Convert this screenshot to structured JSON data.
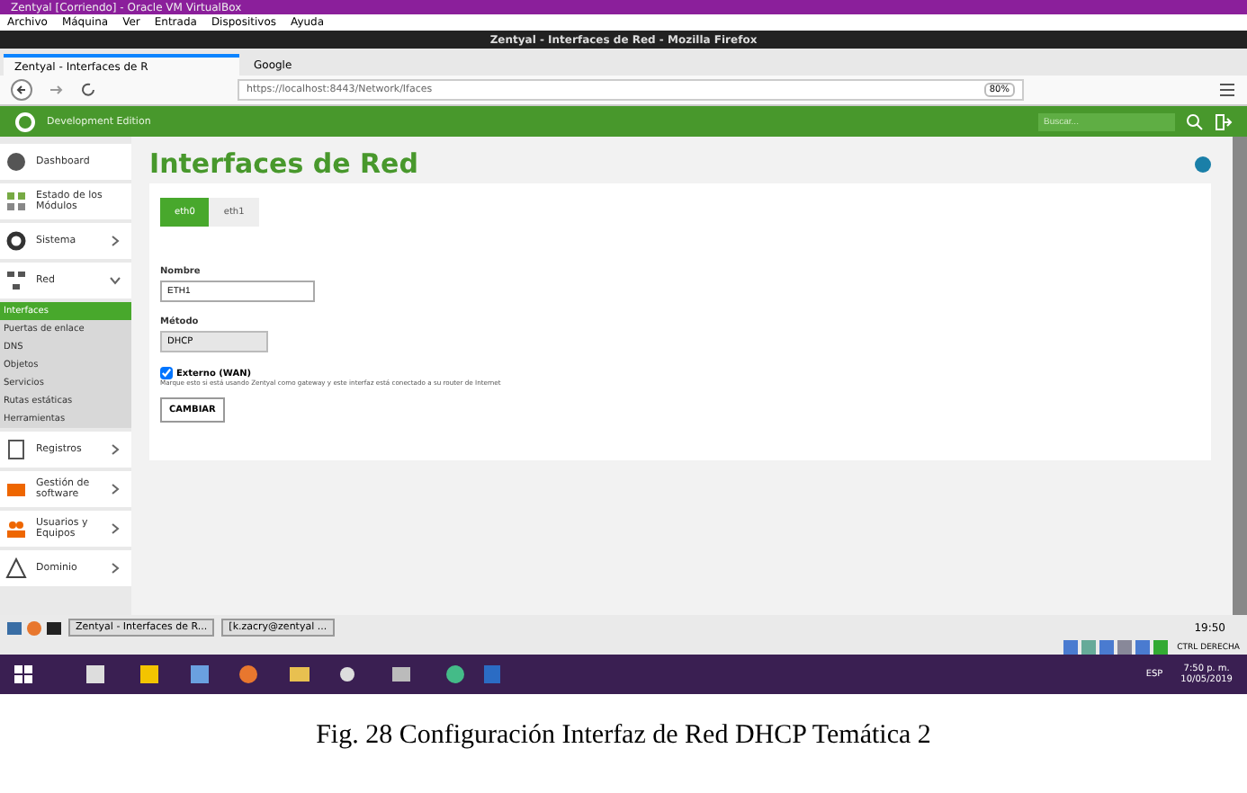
{
  "vm_window": {
    "title": "Zentyal [Corriendo] - Oracle VM VirtualBox",
    "menu": [
      "Archivo",
      "Máquina",
      "Ver",
      "Entrada",
      "Dispositivos",
      "Ayuda"
    ]
  },
  "browser": {
    "title": "Zentyal - Interfaces de Red - Mozilla Firefox",
    "tabs": [
      {
        "label": "Zentyal - Interfaces de R",
        "selected": true
      },
      {
        "label": "Google",
        "selected": false
      }
    ],
    "url": "https://localhost:8443/Network/Ifaces",
    "zoom": "80%"
  },
  "header": {
    "edition": "Development Edition",
    "search": {
      "placeholder": "Buscar..."
    }
  },
  "sidebar": {
    "items": [
      {
        "label": "Dashboard"
      },
      {
        "label": "Estado de los Módulos"
      },
      {
        "label": "Sistema",
        "expanded": false
      },
      {
        "label": "Red",
        "expanded": true,
        "children": [
          {
            "label": "Interfaces",
            "selected": true
          },
          {
            "label": "Puertas de enlace",
            "selected": false
          },
          {
            "label": "DNS",
            "selected": false
          },
          {
            "label": "Objetos",
            "selected": false
          },
          {
            "label": "Servicios",
            "selected": false
          },
          {
            "label": "Rutas estáticas",
            "selected": false
          },
          {
            "label": "Herramientas",
            "selected": false
          }
        ]
      },
      {
        "label": "Registros",
        "expanded": false
      },
      {
        "label": "Gestión de software",
        "expanded": false
      },
      {
        "label": "Usuarios y Equipos",
        "expanded": false
      },
      {
        "label": "Dominio",
        "expanded": false
      }
    ]
  },
  "page": {
    "title": "Interfaces de Red",
    "tabs": [
      {
        "label": "eth0",
        "selected": true
      },
      {
        "label": "eth1",
        "selected": false
      }
    ],
    "name_label": "Nombre",
    "name_value": "ETH1",
    "method_label": "Método",
    "method_value": "DHCP",
    "external": {
      "label": "Externo (WAN)",
      "checked": true,
      "help": "Marque esto si está usando Zentyal como gateway y este interfaz está conectado a su router de Internet"
    },
    "button": "CAMBIAR"
  },
  "vm_taskbar": {
    "items": [
      "Zentyal - Interfaces de R...",
      "[k.zacry@zentyal ..."
    ],
    "clock": "19:50",
    "host_key": "CTRL DERECHA"
  },
  "windows_taskbar": {
    "time": "7:50 p. m.",
    "date": "10/05/2019",
    "lang": "ESP"
  },
  "caption": "Fig. 28 Configuración Interfaz de Red DHCP Temática 2"
}
